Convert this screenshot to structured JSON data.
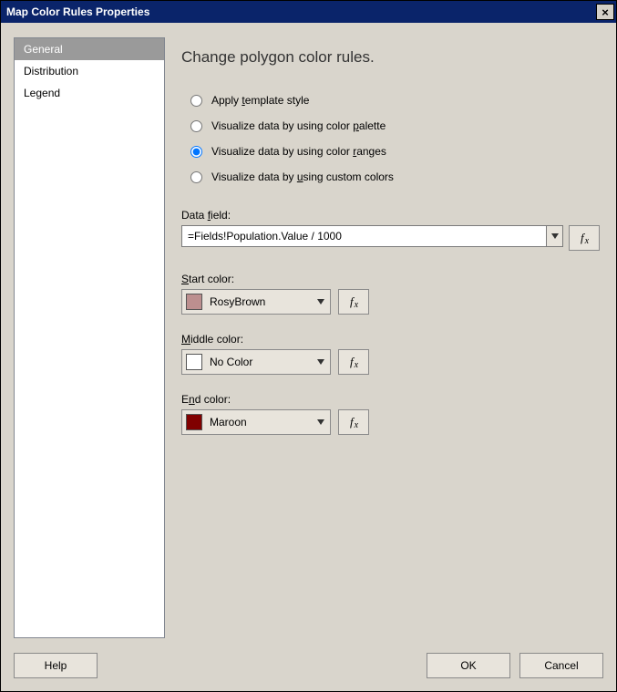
{
  "window": {
    "title": "Map Color Rules Properties",
    "close_icon": "×"
  },
  "sidebar": {
    "items": [
      {
        "label": "General",
        "selected": true
      },
      {
        "label": "Distribution",
        "selected": false
      },
      {
        "label": "Legend",
        "selected": false
      }
    ]
  },
  "main": {
    "heading": "Change polygon color rules.",
    "radios": {
      "template": {
        "pre": "Apply ",
        "u": "t",
        "post": "emplate style"
      },
      "palette": {
        "pre": "Visualize data by using color ",
        "u": "p",
        "post": "alette"
      },
      "ranges": {
        "pre": "Visualize data by using color ",
        "u": "r",
        "post": "anges"
      },
      "custom": {
        "pre": "Visualize data by ",
        "u": "u",
        "post": "sing custom colors"
      }
    },
    "selected_radio": "ranges",
    "data_field": {
      "label_pre": "Data ",
      "label_u": "f",
      "label_post": "ield:",
      "value": "=Fields!Population.Value / 1000"
    },
    "start_color": {
      "label_u": "S",
      "label_post": "tart color:",
      "name": "RosyBrown",
      "hex": "#bc8f8f"
    },
    "middle_color": {
      "label_u": "M",
      "label_post": "iddle color:",
      "name": "No Color",
      "hex": "#ffffff"
    },
    "end_color": {
      "label_pre": "E",
      "label_u": "n",
      "label_post": "d color:",
      "name": "Maroon",
      "hex": "#800000"
    },
    "fx_label_f": "f",
    "fx_label_x": "x"
  },
  "footer": {
    "help": "Help",
    "ok": "OK",
    "cancel": "Cancel"
  }
}
